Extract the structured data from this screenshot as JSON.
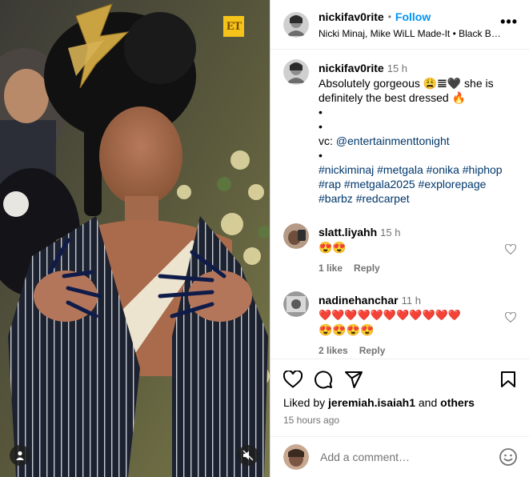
{
  "media": {
    "watermark": "ET"
  },
  "header": {
    "username": "nickifav0rite",
    "separator": "•",
    "follow_label": "Follow",
    "audio": "Nicki Minaj, Mike WiLL Made-It • Black Barbie",
    "more": "•••"
  },
  "caption": {
    "username": "nickifav0rite",
    "time": "15 h",
    "line1": "Absolutely gorgeous 😩𝌆🖤 she is",
    "line2": "definitely the best dressed 🔥",
    "bullet": "•",
    "vc_prefix": "vc: ",
    "vc_tag": "@entertainmenttonight",
    "hashtags_line1": "#nickiminaj #metgala #onika #hiphop",
    "hashtags_line2": "#rap #metgala2025 #explorepage",
    "hashtags_line3": "#barbz #redcarpet"
  },
  "comments": [
    {
      "username": "slatt.liyahh",
      "time": "15 h",
      "text": "😍😍",
      "likes": "1 like",
      "reply": "Reply"
    },
    {
      "username": "nadinehanchar",
      "time": "11 h",
      "text_line1": "❤️❤️❤️❤️❤️❤️❤️❤️❤️❤️❤️",
      "text_line2": "😍😍😍😍",
      "likes": "2 likes",
      "reply": "Reply"
    }
  ],
  "actions": {
    "liked_by_prefix": "Liked by ",
    "liked_by_user": "jeremiah.isaiah1",
    "liked_by_and": " and ",
    "liked_by_others": "others",
    "time_ago": "15 hours ago"
  },
  "add_comment": {
    "placeholder": "Add a comment…"
  },
  "colors": {
    "accent": "#0095f6",
    "tag": "#00376b",
    "muted": "#737373"
  }
}
